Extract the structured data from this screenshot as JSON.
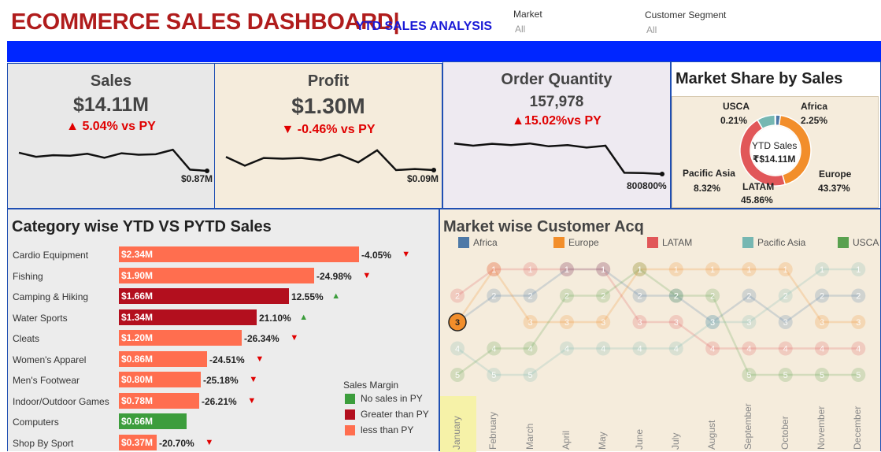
{
  "header": {
    "title": "ECOMMERCE SALES DASHBOARD|",
    "subtitle": "YTD SALES ANALYSIS",
    "filters": [
      {
        "label": "Market",
        "value": "All"
      },
      {
        "label": "Customer Segment",
        "value": "All"
      }
    ]
  },
  "kpis": {
    "sales": {
      "title": "Sales",
      "value": "$14.11M",
      "delta": "▲ 5.04% vs PY",
      "end_label": "$0.87M",
      "trend": [
        0.72,
        0.56,
        0.62,
        0.6,
        0.68,
        0.52,
        0.7,
        0.64,
        0.66,
        0.84,
        0.05,
        0.0
      ]
    },
    "profit": {
      "title": "Profit",
      "value": "$1.30M",
      "delta": "▼  -0.46% vs PY",
      "end_label": "$0.09M",
      "trend": [
        0.6,
        0.2,
        0.55,
        0.52,
        0.55,
        0.45,
        0.7,
        0.35,
        0.9,
        0.0,
        0.05,
        0.0
      ]
    },
    "quantity": {
      "title": "Order Quantity",
      "value": "157,978",
      "delta": "▲15.02%vs PY",
      "end_label": "800800%",
      "trend": [
        0.97,
        0.9,
        0.96,
        0.92,
        0.97,
        0.88,
        0.92,
        0.84,
        0.9,
        0.04,
        0.03,
        0.0
      ]
    }
  },
  "market_share": {
    "title": "Market Share by Sales",
    "center_label": "YTD Sales",
    "center_value": "₹$14.11M",
    "slices": [
      {
        "name": "Africa",
        "pct": "2.25%",
        "value": 2.25,
        "color": "#4e79a7"
      },
      {
        "name": "Europe",
        "pct": "43.37%",
        "value": 43.37,
        "color": "#f28e2b"
      },
      {
        "name": "LATAM",
        "pct": "45.86%",
        "value": 45.86,
        "color": "#e15759"
      },
      {
        "name": "Pacific Asia",
        "pct": "8.32%",
        "value": 8.32,
        "color": "#76b7b2"
      },
      {
        "name": "USCA",
        "pct": "0.21%",
        "value": 0.21,
        "color": "#59a14f"
      }
    ]
  },
  "category": {
    "title": "Category wise YTD VS PYTD Sales",
    "legend_title": "Sales Margin",
    "legend": [
      {
        "label": "No sales in PY",
        "color": "#3c9d3c"
      },
      {
        "label": "Greater than PY",
        "color": "#b30f1e"
      },
      {
        "label": "less than PY",
        "color": "#ff6e4f"
      }
    ]
  },
  "chart_data": [
    {
      "type": "bar",
      "title": "Category wise YTD VS PYTD Sales",
      "categories": [
        "Cardio Equipment",
        "Fishing",
        "Camping & Hiking",
        "Water Sports",
        "Cleats",
        "Women's Apparel",
        "Men's Footwear",
        "Indoor/Outdoor Games",
        "Computers",
        "Shop By Sport"
      ],
      "values": [
        2.34,
        1.9,
        1.66,
        1.34,
        1.2,
        0.86,
        0.8,
        0.78,
        0.66,
        0.37
      ],
      "value_labels": [
        "$2.34M",
        "$1.90M",
        "$1.66M",
        "$1.34M",
        "$1.20M",
        "$0.86M",
        "$0.80M",
        "$0.78M",
        "$0.66M",
        "$0.37M"
      ],
      "change": [
        "-4.05%",
        "-24.98%",
        "12.55%",
        "21.10%",
        "-26.34%",
        "-24.51%",
        "-25.18%",
        "-26.21%",
        "",
        "-20.70%"
      ],
      "margin_class": [
        "less",
        "less",
        "greater",
        "greater",
        "less",
        "less",
        "less",
        "less",
        "none",
        "less"
      ]
    },
    {
      "type": "line",
      "title": "Market wise Customer Acq",
      "x": [
        "January",
        "February",
        "March",
        "April",
        "May",
        "June",
        "July",
        "August",
        "September",
        "October",
        "November",
        "December"
      ],
      "series": [
        {
          "name": "Africa",
          "color": "#4e79a7",
          "rank": [
            3,
            2,
            2,
            1,
            1,
            2,
            2,
            3,
            2,
            3,
            2,
            2
          ]
        },
        {
          "name": "Europe",
          "color": "#f28e2b",
          "rank": [
            3,
            1,
            3,
            3,
            3,
            1,
            1,
            1,
            1,
            1,
            3,
            3
          ]
        },
        {
          "name": "LATAM",
          "color": "#e15759",
          "rank": [
            2,
            1,
            1,
            1,
            1,
            3,
            3,
            4,
            4,
            4,
            4,
            4
          ]
        },
        {
          "name": "Pacific Asia",
          "color": "#76b7b2",
          "rank": [
            4,
            5,
            5,
            4,
            4,
            4,
            4,
            3,
            3,
            2,
            1,
            1
          ]
        },
        {
          "name": "USCA",
          "color": "#59a14f",
          "rank": [
            5,
            4,
            4,
            2,
            2,
            1,
            2,
            2,
            5,
            5,
            5,
            5
          ]
        }
      ],
      "y_ticks": [
        "1",
        "2",
        "3",
        "4",
        "5"
      ],
      "highlight_label": "3"
    }
  ]
}
